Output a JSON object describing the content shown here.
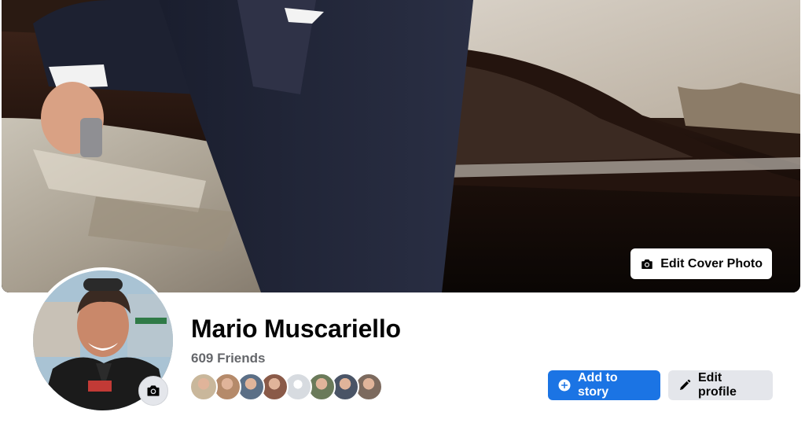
{
  "cover": {
    "edit_cover_label": "Edit Cover Photo"
  },
  "profile": {
    "name": "Mario Muscariello",
    "friends_count_label": "609 Friends",
    "friend_avatars": [
      {
        "color": "#c9b79b"
      },
      {
        "color": "#b58a6a"
      },
      {
        "color": "#5b6f86"
      },
      {
        "color": "#8a5a48"
      },
      {
        "color": "#d7dbe0"
      },
      {
        "color": "#6a7a5a"
      },
      {
        "color": "#4a5466"
      },
      {
        "color": "#7c6a5e"
      }
    ]
  },
  "actions": {
    "add_story_label": "Add to story",
    "edit_profile_label": "Edit profile"
  },
  "colors": {
    "primary": "#1b74e4",
    "secondary_button": "#e4e6eb",
    "text_primary": "#050505",
    "text_secondary": "#65676b"
  },
  "icons": {
    "cover_camera": "camera-icon",
    "avatar_camera": "camera-icon",
    "add_story": "plus-circle-icon",
    "edit_profile": "pencil-icon"
  }
}
